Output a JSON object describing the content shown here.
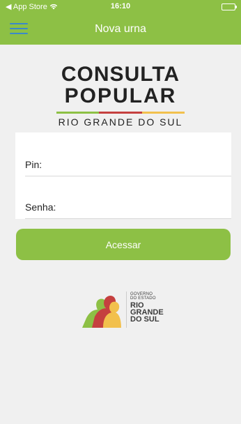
{
  "status_bar": {
    "back_label": "◀ App Store",
    "time": "16:10"
  },
  "navbar": {
    "title": "Nova urna",
    "menu_icon": "hamburger-icon"
  },
  "logo": {
    "line1": "CONSULTA",
    "line2": "POPULAR",
    "line3": "RIO GRANDE DO SUL",
    "stripe_colors": [
      "#8dc045",
      "#c5403f",
      "#f2c04d"
    ]
  },
  "form": {
    "pin_label": "Pin:",
    "password_label": "Senha:"
  },
  "submit_label": "Acessar",
  "footer_logo": {
    "line1": "GOVERNO",
    "line2": "DO ESTADO",
    "line3": "RIO",
    "line4": "GRANDE",
    "line5": "DO SUL"
  },
  "colors": {
    "accent": "#8dc045",
    "menu_icon": "#3a89c9"
  }
}
